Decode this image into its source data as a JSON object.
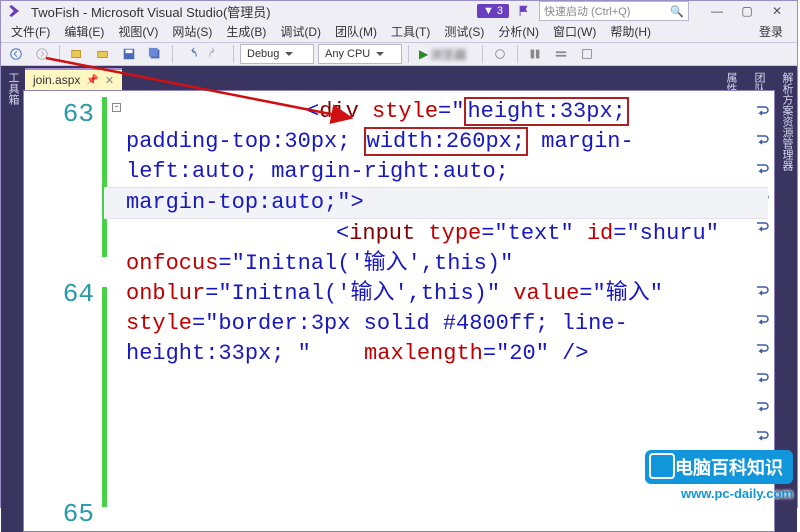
{
  "titlebar": {
    "title": "TwoFish - Microsoft Visual Studio(管理员)",
    "notif_count": "3",
    "quick_launch_placeholder": "快速启动 (Ctrl+Q)"
  },
  "menubar": {
    "items": [
      {
        "label": "文件(F)"
      },
      {
        "label": "编辑(E)"
      },
      {
        "label": "视图(V)"
      },
      {
        "label": "网站(S)"
      },
      {
        "label": "生成(B)"
      },
      {
        "label": "调试(D)"
      },
      {
        "label": "团队(M)"
      },
      {
        "label": "工具(T)"
      },
      {
        "label": "测试(S)"
      },
      {
        "label": "分析(N)"
      },
      {
        "label": "窗口(W)"
      },
      {
        "label": "帮助(H)"
      }
    ],
    "login": "登录"
  },
  "toolbar": {
    "config": "Debug",
    "platform": "Any CPU",
    "run_label": "▶"
  },
  "left_rail": {
    "label": "工具箱"
  },
  "right_rail": {
    "labels": [
      "解析方案资源管理器",
      "团队资源管理器",
      "属性"
    ]
  },
  "file_tab": {
    "name": "join.aspx",
    "pin": "📌",
    "close": "✕"
  },
  "gutter": {
    "lines": [
      "63",
      "",
      "",
      "",
      "",
      "",
      "64",
      "",
      "",
      "",
      "",
      "",
      "",
      "65"
    ]
  },
  "code": {
    "div_tag": "div",
    "style_attr": "style",
    "hl1": "height:33px;",
    "seg_pad": " padding-top:30px; ",
    "hl2": "width:260px;",
    "seg_rest1": " margin-left:auto; margin-right:auto; ",
    "seg_rest2": "margin-top:auto;\"",
    "close_angle": ">",
    "input_tag": "input",
    "type_attr": "type",
    "type_val": "text",
    "id_attr": "id",
    "id_val": "shuru",
    "onfocus_attr": "onfocus",
    "onfocus_val": "Initnal('输入',this)",
    "onblur_attr": "onblur",
    "onblur_val": "Initnal('输入',this)",
    "value_attr": "value",
    "value_val": "输入",
    "style2_attr": "style",
    "style2_val": "border:3px solid #4800ff; line-height:33px; ",
    "maxlen_attr": "maxlength",
    "maxlen_val": "20",
    "selfclose": " />"
  },
  "watermark": {
    "title": "电脑百科知识",
    "url": "www.pc-daily.com"
  }
}
